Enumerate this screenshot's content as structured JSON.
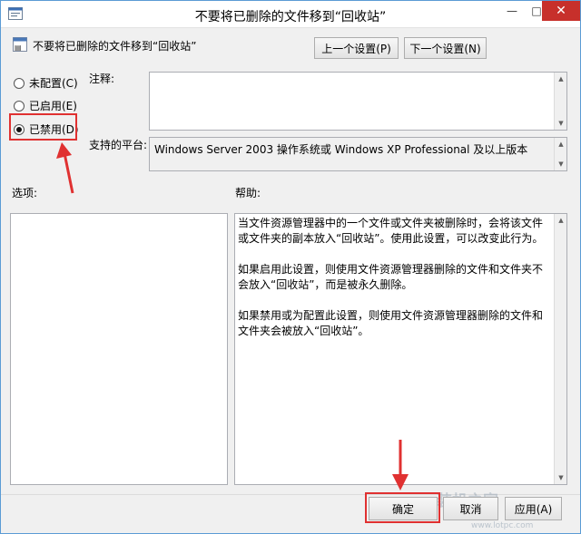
{
  "window": {
    "title": "不要将已删除的文件移到“回收站”",
    "minimize_glyph": "—",
    "maximize_glyph": "□",
    "close_glyph": "✕"
  },
  "header": {
    "policy_name": "不要将已删除的文件移到“回收站”",
    "prev_button": "上一个设置(P)",
    "next_button": "下一个设置(N)"
  },
  "radios": [
    {
      "label": "未配置(C)",
      "checked": false
    },
    {
      "label": "已启用(E)",
      "checked": false
    },
    {
      "label": "已禁用(D)",
      "checked": true
    }
  ],
  "labels": {
    "comment": "注释:",
    "platform": "支持的平台:",
    "options": "选项:",
    "help": "帮助:"
  },
  "platform_text": "Windows Server 2003 操作系统或 Windows XP Professional 及以上版本",
  "help_paragraphs": [
    "当文件资源管理器中的一个文件或文件夹被删除时，会将该文件或文件夹的副本放入“回收站”。使用此设置，可以改变此行为。",
    "如果启用此设置，则使用文件资源管理器删除的文件和文件夹不会放入“回收站”，而是被永久删除。",
    "如果禁用或为配置此设置，则使用文件资源管理器删除的文件和文件夹会被放入“回收站”。"
  ],
  "footer": {
    "ok": "确定",
    "cancel": "取消",
    "apply": "应用(A)"
  },
  "watermark": {
    "brand": "装机之家",
    "url": "www.lotpc.com"
  },
  "colors": {
    "highlight": "#e03131",
    "close_button": "#c7302b"
  }
}
